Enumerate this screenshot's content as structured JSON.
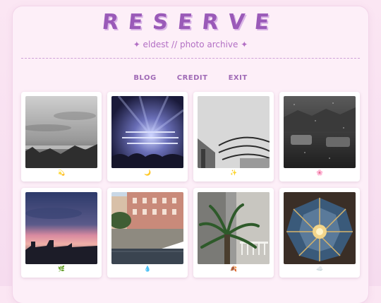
{
  "site": {
    "title": "RESERVE",
    "subtitle": "✦ eldest // photo archive ✦"
  },
  "nav": [
    {
      "label": "BLOG"
    },
    {
      "label": "CREDIT"
    },
    {
      "label": "EXIT"
    }
  ],
  "gallery": [
    {
      "emoji": "💫",
      "theme": "cloudy-sky-grayscale"
    },
    {
      "emoji": "🌙",
      "theme": "concert-lights"
    },
    {
      "emoji": "✨",
      "theme": "arches-grayscale"
    },
    {
      "emoji": "🌸",
      "theme": "rainy-window"
    },
    {
      "emoji": "🌿",
      "theme": "sunset-skyline"
    },
    {
      "emoji": "💧",
      "theme": "canal-buildings"
    },
    {
      "emoji": "🍂",
      "theme": "palm-balcony"
    },
    {
      "emoji": "☁️",
      "theme": "ornate-ceiling"
    }
  ]
}
